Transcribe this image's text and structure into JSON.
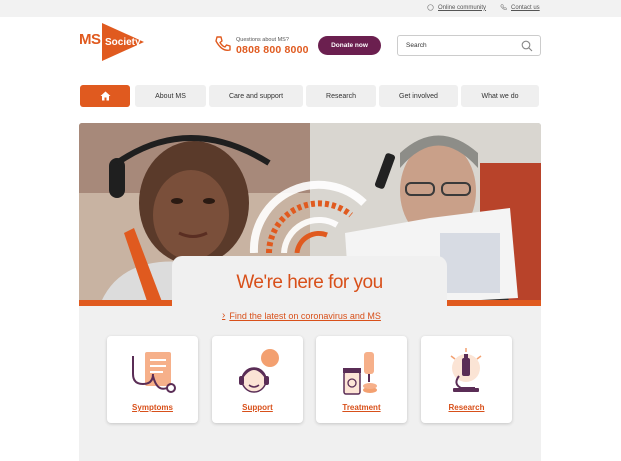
{
  "topbar": {
    "online_community": "Online community",
    "contact_us": "Contact us"
  },
  "brand": {
    "ms": "MS",
    "society": "Society",
    "accent": "#e05a1f",
    "purple": "#6b1f4f"
  },
  "phone": {
    "question": "Questions about MS?",
    "number": "0808 800 8000"
  },
  "donate_label": "Donate now",
  "search": {
    "placeholder": "Search"
  },
  "nav": {
    "home_icon": "home-icon",
    "items": [
      {
        "label": "About MS"
      },
      {
        "label": "Care and support"
      },
      {
        "label": "Research"
      },
      {
        "label": "Get involved"
      },
      {
        "label": "What we do"
      }
    ]
  },
  "hero": {
    "title": "We're here for you",
    "link": "Find the latest on coronavirus and MS"
  },
  "cards": [
    {
      "label": "Symptoms",
      "icon": "symptoms-icon"
    },
    {
      "label": "Support",
      "icon": "support-icon"
    },
    {
      "label": "Treatment",
      "icon": "treatment-icon"
    },
    {
      "label": "Research",
      "icon": "research-icon"
    }
  ]
}
